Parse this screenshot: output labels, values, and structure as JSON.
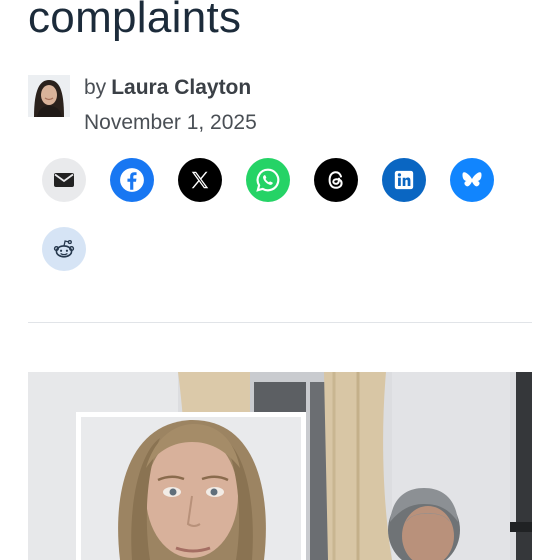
{
  "article": {
    "headline": "complaints",
    "byline_prefix": "by",
    "author": "Laura Clayton",
    "date": "November 1, 2025"
  },
  "share_buttons": [
    {
      "icon": "email-icon",
      "color": "#e9eaec"
    },
    {
      "icon": "facebook-icon",
      "color": "#1877f2"
    },
    {
      "icon": "x-icon",
      "color": "#000000"
    },
    {
      "icon": "whatsapp-icon",
      "color": "#25d366"
    },
    {
      "icon": "threads-icon",
      "color": "#000000"
    },
    {
      "icon": "linkedin-icon",
      "color": "#0a66c2"
    },
    {
      "icon": "bluesky-icon",
      "color": "#1185fe"
    },
    {
      "icon": "reddit-icon",
      "color": "#d6e4f5"
    }
  ],
  "colors": {
    "headline": "#1c2b3a",
    "divider": "#e1e4e8"
  }
}
